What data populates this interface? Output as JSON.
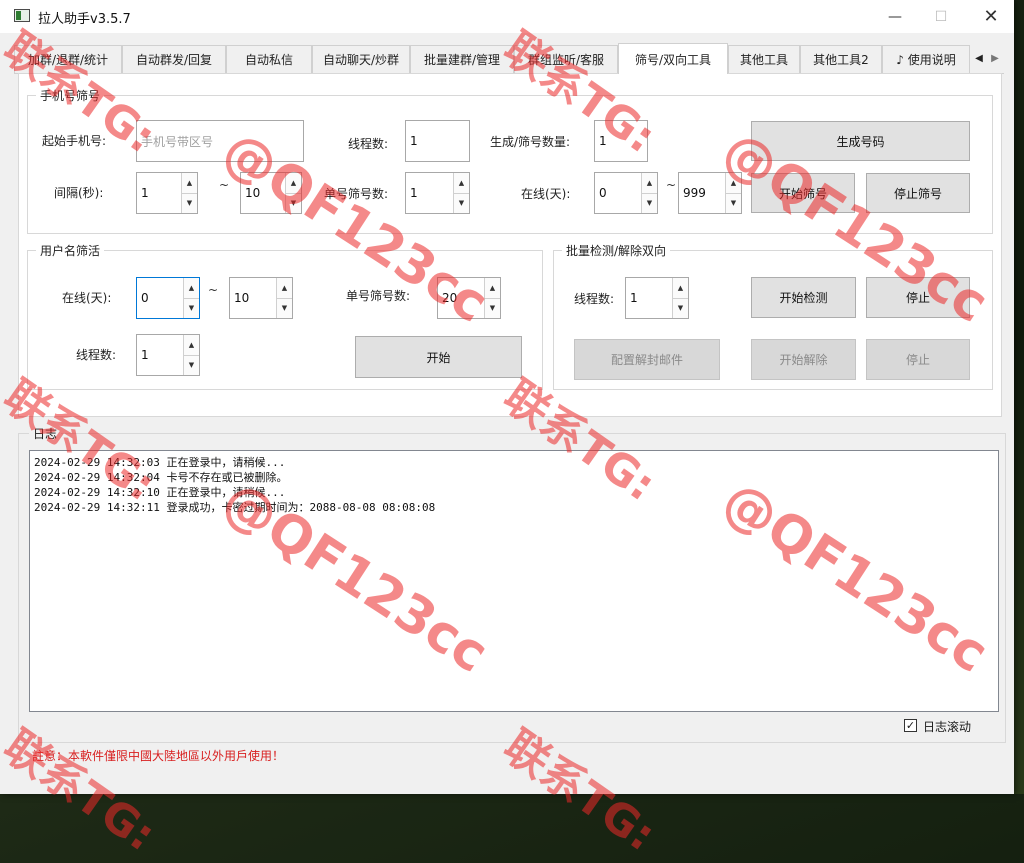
{
  "window": {
    "title": "拉人助手v3.5.7",
    "minimize_glyph": "—",
    "maximize_glyph": "☐",
    "close_glyph": "✕"
  },
  "tabs": [
    "加群/退群/统计",
    "自动群发/回复",
    "自动私信",
    "自动聊天/炒群",
    "批量建群/管理",
    "群组监听/客服",
    "筛号/双向工具",
    "其他工具",
    "其他工具2",
    "♪ 使用说明"
  ],
  "active_tab": "筛号/双向工具",
  "phone_group": {
    "title": "手机号筛号",
    "start_phone_label": "起始手机号:",
    "start_phone_placeholder": "手机号带区号",
    "threads_label": "线程数:",
    "threads_value": "1",
    "gen_count_label": "生成/筛号数量:",
    "gen_count_value": "1",
    "generate_button": "生成号码",
    "interval_label": "间隔(秒):",
    "interval_from": "1",
    "interval_to": "10",
    "per_number_label": "单号筛号数:",
    "per_number_value": "1",
    "online_label": "在线(天):",
    "online_from": "0",
    "online_to": "999",
    "start_button": "开始筛号",
    "stop_button": "停止筛号"
  },
  "username_group": {
    "title": "用户名筛活",
    "online_label": "在线(天):",
    "online_from": "0",
    "online_to": "10",
    "per_number_label": "单号筛号数:",
    "per_number_value": "20",
    "threads_label": "线程数:",
    "threads_value": "1",
    "start_button": "开始"
  },
  "bidirectional_group": {
    "title": "批量检测/解除双向",
    "threads_label": "线程数:",
    "threads_value": "1",
    "start_check_button": "开始检测",
    "stop_button": "停止",
    "config_button": "配置解封邮件",
    "start_release_button": "开始解除",
    "stop2_button": "停止"
  },
  "tilde": "~",
  "log": {
    "title": "日志",
    "lines": [
      "2024-02-29 14:32:03 正在登录中，请稍候...",
      "2024-02-29 14:32:04 卡号不存在或已被删除。",
      "2024-02-29 14:32:10 正在登录中，请稍候...",
      "2024-02-29 14:32:11 登录成功，卡密过期时间为：2088-08-08 08:08:08"
    ],
    "autoscroll_label": "日志滚动",
    "autoscroll_checked": "✓"
  },
  "notice": "註意：本軟件僅限中國大陸地區以外用戶使用！",
  "watermark_lines": [
    "联系TG:",
    "@QF123cc"
  ]
}
